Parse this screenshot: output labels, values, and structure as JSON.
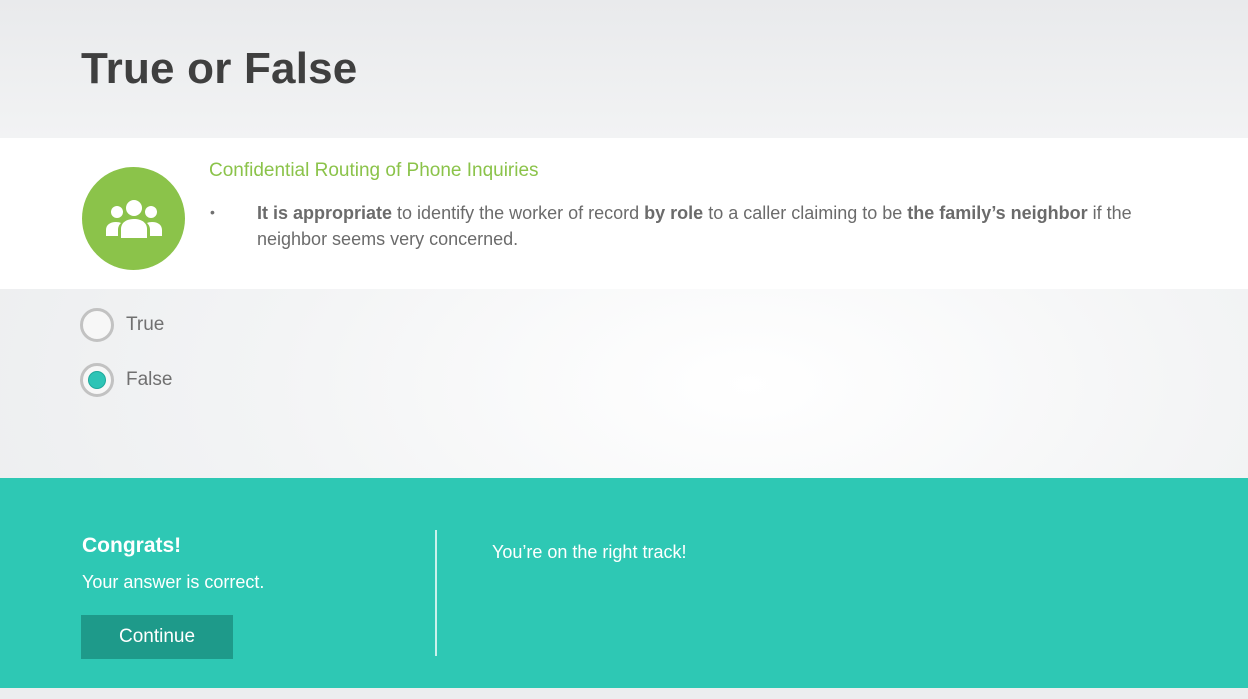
{
  "page": {
    "title": "True or False"
  },
  "question": {
    "heading": "Confidential Routing of Phone Inquiries",
    "bullet": "•",
    "parts": [
      {
        "text": "It is appropriate",
        "bold": true
      },
      {
        "text": " to identify the worker of record ",
        "bold": false
      },
      {
        "text": "by role",
        "bold": true
      },
      {
        "text": " to a caller claiming to be ",
        "bold": false
      },
      {
        "text": "the family’s neighbor",
        "bold": true
      },
      {
        "text": " if the neighbor seems very concerned.",
        "bold": false
      }
    ],
    "icon": "group-users-icon",
    "icon_color": "#8bc34a"
  },
  "options": [
    {
      "label": "True",
      "selected": false
    },
    {
      "label": "False",
      "selected": true
    }
  ],
  "feedback": {
    "title": "Congrats!",
    "subtitle": "Your answer is correct.",
    "continue_label": "Continue",
    "message": "You’re on the right track!",
    "background": "#2ec8b4",
    "button_color": "#1e9a8a"
  }
}
